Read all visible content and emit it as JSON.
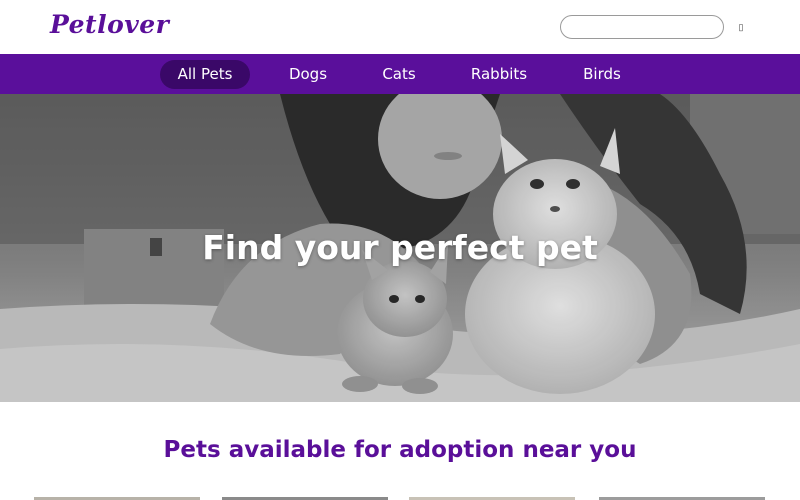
{
  "header": {
    "logo": "Petlover",
    "search": {
      "placeholder": "",
      "value": "",
      "button_icon": "search-icon",
      "button_glyph": "▯"
    }
  },
  "nav": {
    "items": [
      {
        "label": "All Pets",
        "active": true
      },
      {
        "label": "Dogs",
        "active": false
      },
      {
        "label": "Cats",
        "active": false
      },
      {
        "label": "Rabbits",
        "active": false
      },
      {
        "label": "Birds",
        "active": false
      }
    ]
  },
  "hero": {
    "title": "Find your perfect pet",
    "image": "girl-with-two-kittens-photo"
  },
  "adoption": {
    "title": "Pets available for adoption near you"
  },
  "colors": {
    "brand": "#5a0f99",
    "nav_bg": "#5a0f9b",
    "nav_active": "#3a0868"
  }
}
